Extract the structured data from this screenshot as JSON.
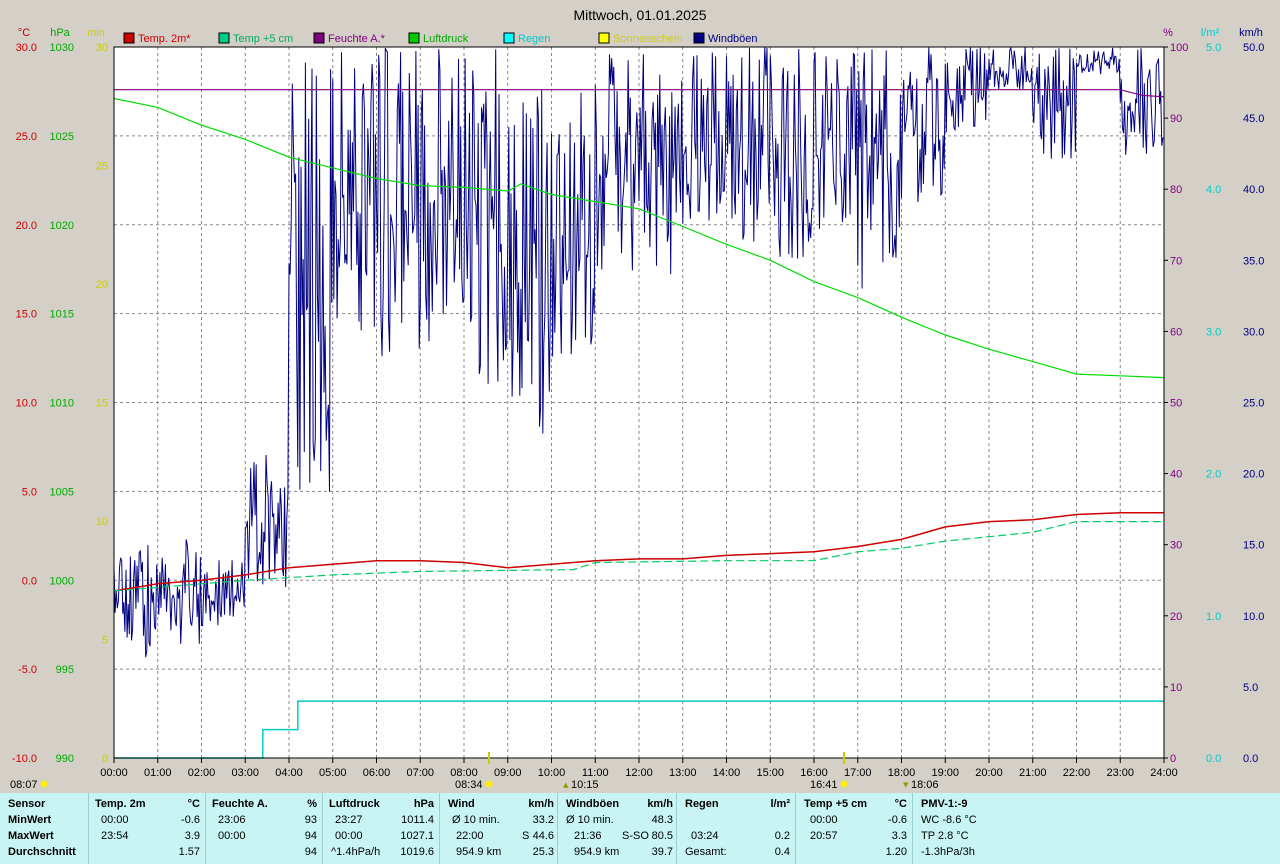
{
  "title": "Mittwoch, 01.01.2025",
  "axis_units": {
    "temp": "°C",
    "pressure": "hPa",
    "sun": "min",
    "humidity": "%",
    "rain": "l/m²",
    "wind": "km/h"
  },
  "legend": [
    {
      "label": "Temp. 2m*",
      "color": "#cc0000"
    },
    {
      "label": "Temp +5 cm",
      "color": "#00cc88"
    },
    {
      "label": "Feuchte A.*",
      "color": "#800080"
    },
    {
      "label": "Luftdruck",
      "color": "#00cc00"
    },
    {
      "label": "Regen",
      "color": "#00ffff"
    },
    {
      "label": "Sonnenschein",
      "color": "#ffff00"
    },
    {
      "label": "Windböen",
      "color": "#000080"
    }
  ],
  "colors": {
    "temp": "#cc0000",
    "pressure": "#00aa00",
    "sun": "#ffff00",
    "humidity": "#800080",
    "rain": "#00cccc",
    "wind": "#000080",
    "temp5": "#00cc66"
  },
  "markers": {
    "sunrise": "08:34",
    "sunset": "16:41",
    "moon1": "10:15",
    "moon2": "18:06",
    "bottom_left": "08:07"
  },
  "chart_data": {
    "type": "line",
    "title": "Mittwoch, 01.01.2025",
    "x_ticks": [
      "00:00",
      "01:00",
      "02:00",
      "03:00",
      "04:00",
      "05:00",
      "06:00",
      "07:00",
      "08:00",
      "09:00",
      "10:00",
      "11:00",
      "12:00",
      "13:00",
      "14:00",
      "15:00",
      "16:00",
      "17:00",
      "18:00",
      "19:00",
      "20:00",
      "21:00",
      "22:00",
      "23:00",
      "24:00"
    ],
    "axes": {
      "temp": {
        "unit": "°C",
        "ylim": [
          -10,
          30
        ],
        "ticks": [
          "30.0",
          "25.0",
          "20.0",
          "15.0",
          "10.0",
          "5.0",
          "0.0",
          "-5.0",
          "-10.0"
        ]
      },
      "pressure": {
        "unit": "hPa",
        "ylim": [
          990,
          1030
        ],
        "ticks": [
          "1030",
          "1025",
          "1020",
          "1015",
          "1010",
          "1005",
          "1000",
          "995",
          "990"
        ]
      },
      "sun": {
        "unit": "min",
        "ylim": [
          0,
          30
        ],
        "ticks": [
          "30",
          "25",
          "20",
          "15",
          "10",
          "5",
          "0"
        ]
      },
      "humidity": {
        "unit": "%",
        "ylim": [
          0,
          100
        ],
        "ticks": [
          "100",
          "90",
          "80",
          "70",
          "60",
          "50",
          "40",
          "30",
          "20",
          "10",
          "0"
        ]
      },
      "rain": {
        "unit": "l/m²",
        "ylim": [
          0,
          5
        ],
        "ticks": [
          "5.0",
          "4.0",
          "3.0",
          "2.0",
          "1.0",
          "0.0"
        ]
      },
      "wind": {
        "unit": "km/h",
        "ylim": [
          0,
          50
        ],
        "ticks": [
          "50.0",
          "45.0",
          "40.0",
          "35.0",
          "30.0",
          "25.0",
          "20.0",
          "15.0",
          "10.0",
          "5.0",
          "0.0"
        ]
      }
    },
    "series": [
      {
        "name": "Temp. 2m*",
        "axis": "temp",
        "x": [
          0,
          0.5,
          1,
          2,
          3,
          4,
          5,
          6,
          7,
          8,
          9,
          10,
          11,
          12,
          13,
          14,
          15,
          16,
          17,
          18,
          19,
          20,
          21,
          22,
          23,
          24
        ],
        "y": [
          -0.6,
          -0.4,
          -0.2,
          0.0,
          0.3,
          0.7,
          0.9,
          1.1,
          1.1,
          1.0,
          0.7,
          0.9,
          1.1,
          1.2,
          1.2,
          1.4,
          1.5,
          1.6,
          1.9,
          2.3,
          3.0,
          3.3,
          3.4,
          3.7,
          3.8,
          3.8
        ]
      },
      {
        "name": "Temp +5 cm",
        "axis": "temp",
        "x": [
          0,
          1.5,
          3,
          5,
          7,
          10.5,
          11,
          14,
          16,
          17,
          18,
          19,
          21,
          22,
          23,
          24
        ],
        "y": [
          -0.6,
          -0.3,
          0.0,
          0.3,
          0.5,
          0.6,
          1.0,
          1.1,
          1.1,
          1.6,
          1.8,
          2.2,
          2.7,
          3.3,
          3.3,
          3.3
        ]
      },
      {
        "name": "Feuchte A.*",
        "axis": "humidity",
        "x": [
          0,
          23,
          23.5,
          24
        ],
        "y": [
          94,
          94,
          93.2,
          93
        ]
      },
      {
        "name": "Luftdruck",
        "axis": "pressure",
        "x": [
          0,
          1,
          2,
          3,
          4,
          5,
          6,
          7,
          8,
          9,
          9.3,
          10,
          11,
          12,
          13,
          14,
          15,
          16,
          17,
          18,
          19,
          20,
          21,
          22,
          23,
          24
        ],
        "y": [
          1027.1,
          1026.6,
          1025.6,
          1024.8,
          1023.8,
          1023.2,
          1022.6,
          1022.2,
          1022.1,
          1021.9,
          1022.3,
          1021.7,
          1021.3,
          1020.9,
          1019.9,
          1018.9,
          1018.0,
          1016.8,
          1015.9,
          1014.8,
          1013.8,
          1013.0,
          1012.3,
          1011.6,
          1011.5,
          1011.4
        ]
      },
      {
        "name": "Regen",
        "axis": "rain",
        "x": [
          0,
          3.4,
          3.4,
          4.2,
          4.2,
          24
        ],
        "y": [
          0,
          0,
          0.2,
          0.2,
          0.4,
          0.4
        ]
      }
    ],
    "gusts_hourly": [
      {
        "hour": 0,
        "min": 7,
        "max": 15
      },
      {
        "hour": 1,
        "min": 8,
        "max": 16
      },
      {
        "hour": 2,
        "min": 9,
        "max": 14
      },
      {
        "hour": 3,
        "min": 12,
        "max": 22
      },
      {
        "hour": 4,
        "min": 18,
        "max": 50
      },
      {
        "hour": 5,
        "min": 30,
        "max": 50
      },
      {
        "hour": 6,
        "min": 27,
        "max": 50
      },
      {
        "hour": 7,
        "min": 28,
        "max": 50
      },
      {
        "hour": 8,
        "min": 26,
        "max": 50
      },
      {
        "hour": 9,
        "min": 22,
        "max": 47
      },
      {
        "hour": 10,
        "min": 28,
        "max": 47
      },
      {
        "hour": 11,
        "min": 34,
        "max": 50
      },
      {
        "hour": 12,
        "min": 34,
        "max": 50
      },
      {
        "hour": 13,
        "min": 37,
        "max": 50
      },
      {
        "hour": 14,
        "min": 36,
        "max": 50
      },
      {
        "hour": 15,
        "min": 35,
        "max": 50
      },
      {
        "hour": 16,
        "min": 37,
        "max": 50
      },
      {
        "hour": 17,
        "min": 33,
        "max": 50
      },
      {
        "hour": 18,
        "min": 39,
        "max": 50
      },
      {
        "hour": 19,
        "min": 44,
        "max": 50
      },
      {
        "hour": 20,
        "min": 47,
        "max": 50
      },
      {
        "hour": 21,
        "min": 42,
        "max": 50
      },
      {
        "hour": 22,
        "min": 48,
        "max": 50
      },
      {
        "hour": 23,
        "min": 42,
        "max": 50
      }
    ],
    "grid": true
  },
  "stats": {
    "header": {
      "sensor": "Sensor",
      "temp": "Temp. 2m",
      "temp_u": "°C",
      "hum": "Feuchte A.",
      "hum_u": "%",
      "press": "Luftdruck",
      "press_u": "hPa",
      "wind": "Wind",
      "wind_u": "km/h",
      "gust": "Windböen",
      "gust_u": "km/h",
      "rain": "Regen",
      "rain_u": "l/m²",
      "temp5": "Temp +5 cm",
      "temp5_u": "°C",
      "pmv": "PMV-1:-9"
    },
    "min": {
      "label": "MinWert",
      "temp_t": "00:00",
      "temp_v": "-0.6",
      "hum_t": "23:06",
      "hum_v": "93",
      "press_t": "23:27",
      "press_v": "1011.4",
      "wind_t": "Ø 10 min.",
      "wind_v": "33.2",
      "gust_t": "Ø 10 min.",
      "gust_v": "48.3",
      "temp5_t": "00:00",
      "temp5_v": "-0.6",
      "pmv": "WC -8.6 °C"
    },
    "max": {
      "label": "MaxWert",
      "temp_t": "23:54",
      "temp_v": "3.9",
      "hum_t": "00:00",
      "hum_v": "94",
      "press_t": "00:00",
      "press_v": "1027.1",
      "wind_t": "22:00",
      "wind_dir": "S",
      "wind_v": "44.6",
      "gust_t": "21:36",
      "gust_dir": "S-SO",
      "gust_v": "80.5",
      "rain_t": "03:24",
      "rain_v": "0.2",
      "temp5_t": "20:57",
      "temp5_v": "3.3",
      "pmv": "TP 2.8 °C"
    },
    "avg": {
      "label": "Durchschnitt",
      "temp_v": "1.57",
      "hum_v": "94",
      "press_t": "^1.4hPa/h",
      "press_v": "1019.6",
      "wind_t": "954.9 km",
      "wind_v": "25.3",
      "gust_t": "954.9 km",
      "gust_v": "39.7",
      "rain_t": "Gesamt:",
      "rain_v": "0.4",
      "temp5_v": "1.20",
      "pmv": "-1.3hPa/3h"
    }
  }
}
